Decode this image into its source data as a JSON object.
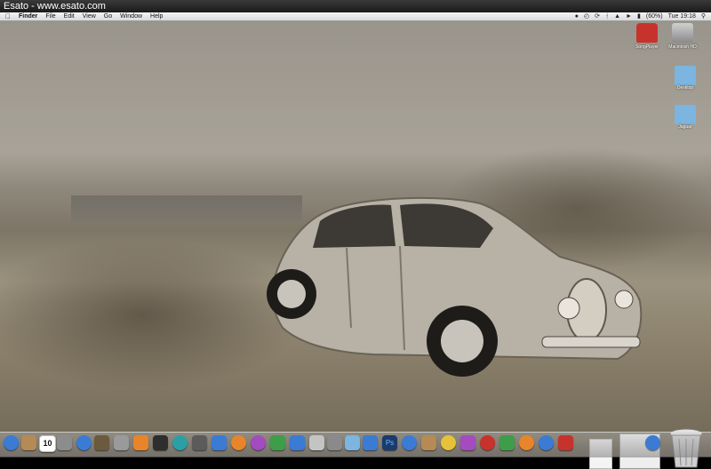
{
  "window": {
    "title": "Esato - www.esato.com"
  },
  "menubar": {
    "apple_icon": "apple-icon",
    "items": [
      "Finder",
      "File",
      "Edit",
      "View",
      "Go",
      "Window",
      "Help"
    ],
    "status": {
      "battery": "(60%)",
      "clock": "Tue 19:18"
    }
  },
  "desktop_icons": [
    {
      "label": "SongPlayer",
      "icon": "siren-app-icon"
    },
    {
      "label": "Macintosh HD",
      "icon": "hard-drive-icon"
    },
    {
      "label": "Desktop",
      "icon": "folder-icon"
    },
    {
      "label": "Jaguar",
      "icon": "folder-icon"
    }
  ],
  "dock": {
    "calendar_day": "10",
    "items": [
      "finder",
      "mail",
      "calendar",
      "preview",
      "itunes",
      "photos",
      "tools",
      "pencil",
      "dashboard",
      "safari",
      "time-machine",
      "preferences",
      "app-store",
      "firefox",
      "photo",
      "messages",
      "network",
      "contacts",
      "folder",
      "printer",
      "scanner",
      "mobile",
      "stack",
      "ps",
      "network2",
      "folder2",
      "camera",
      "rainbow",
      "itunes2",
      "flower",
      "chrome",
      "settings",
      "wireless",
      "browser"
    ],
    "colors": {
      "blue": "#3b7bd4",
      "orange": "#e8852a",
      "purple": "#a34bbf",
      "green": "#3e9d48",
      "red": "#c8322d",
      "gray": "#8a8a8a",
      "yellow": "#e6c23a",
      "teal": "#2aa0a6"
    }
  }
}
